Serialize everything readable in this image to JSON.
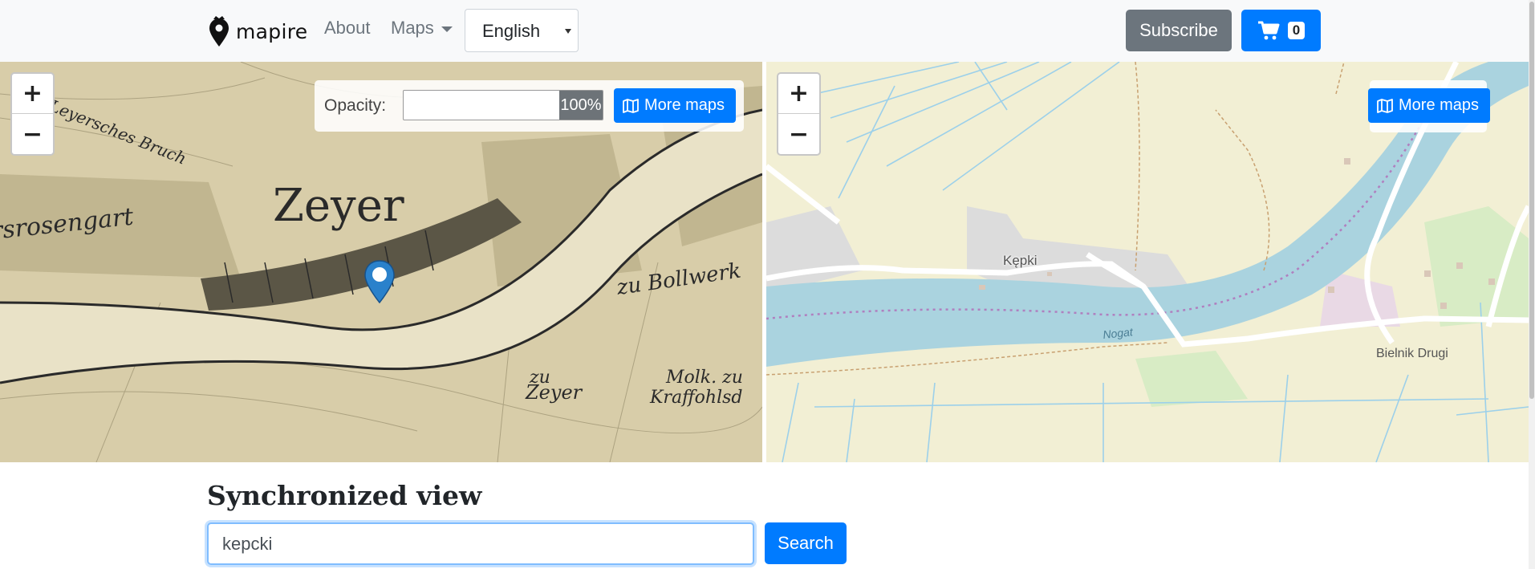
{
  "navbar": {
    "brand": "mapire",
    "about": "About",
    "maps": "Maps",
    "language": "English",
    "subscribe": "Subscribe",
    "cart_count": "0"
  },
  "left_map": {
    "opacity_label": "Opacity:",
    "opacity_value": "100%",
    "more_maps": "More maps"
  },
  "right_map": {
    "more_maps": "More maps",
    "labels": {
      "place1": "Kępki",
      "river": "Nogat",
      "place2": "Bielnik Drugi"
    }
  },
  "zoom": {
    "in": "+",
    "out": "−"
  },
  "main": {
    "title": "Synchronized view",
    "search_value": "kepcki",
    "search_button": "Search"
  },
  "colors": {
    "primary": "#007bff",
    "secondary": "#6c757d",
    "navbar_bg": "#f8f9fa",
    "river": "#aad3df"
  }
}
